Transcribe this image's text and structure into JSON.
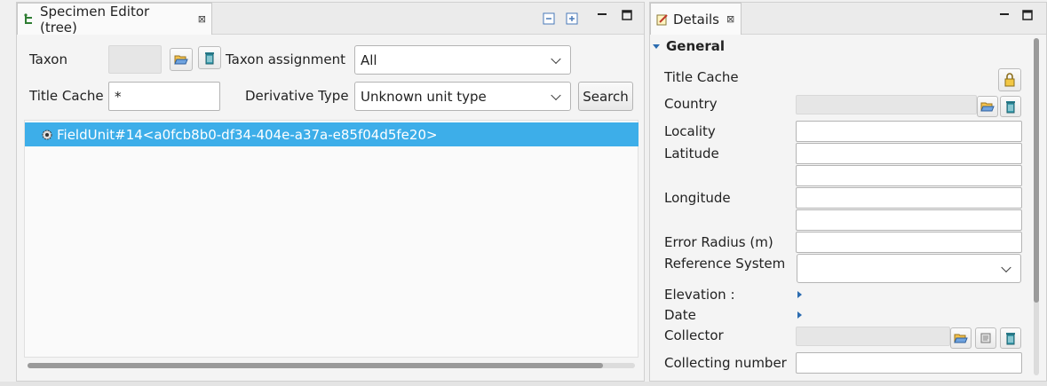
{
  "left_panel": {
    "tab_title": "Specimen Editor (tree)",
    "tab_close": "⊠",
    "taxon_label": "Taxon",
    "taxon_assignment_label": "Taxon assignment",
    "taxon_assignment_value": "All",
    "title_cache_label": "Title Cache",
    "title_cache_value": "*",
    "derivative_type_label": "Derivative Type",
    "derivative_type_value": "Unknown unit type",
    "search_button": "Search",
    "tree_items": [
      {
        "label": "FieldUnit#14<a0fcb8b0-df34-404e-a37a-e85f04d5fe20>",
        "selected": true
      }
    ]
  },
  "right_panel": {
    "tab_title": "Details",
    "tab_close": "⊠",
    "section_title": "General",
    "fields": {
      "title_cache": "Title Cache",
      "country": "Country",
      "locality": "Locality",
      "latitude": "Latitude",
      "longitude": "Longitude",
      "error_radius": "Error Radius (m)",
      "reference_system": "Reference System",
      "elevation": "Elevation :",
      "date": "Date",
      "collector": "Collector",
      "collecting_number": "Collecting number"
    }
  },
  "colors": {
    "selection": "#3daee9",
    "accent": "#2b6cb0"
  }
}
